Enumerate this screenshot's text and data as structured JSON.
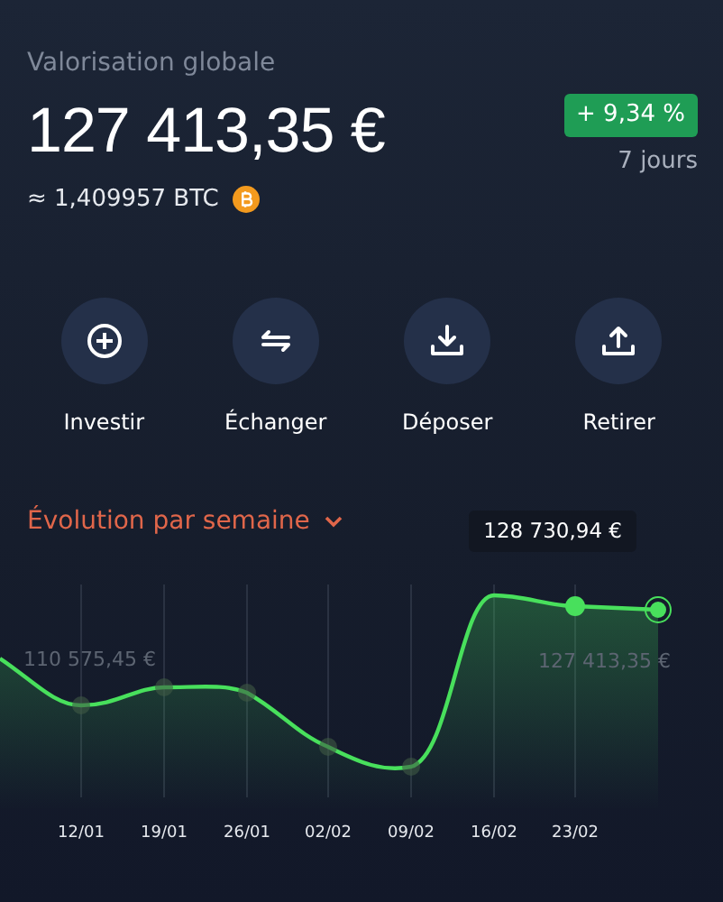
{
  "header": {
    "title": "Valorisation globale",
    "amount": "127 413,35 €",
    "btc_equivalent": "≈ 1,409957 BTC",
    "change": "+ 9,34 %",
    "period": "7 jours"
  },
  "actions": [
    {
      "label": "Investir"
    },
    {
      "label": "Échanger"
    },
    {
      "label": "Déposer"
    },
    {
      "label": "Retirer"
    }
  ],
  "chart": {
    "title": "Évolution par semaine",
    "tooltip": "128 730,94 €",
    "min_label": "110 575,45 €",
    "last_label": "127 413,35 €",
    "x_labels": [
      "12/01",
      "19/01",
      "26/01",
      "02/02",
      "09/02",
      "16/02",
      "23/02"
    ]
  }
}
